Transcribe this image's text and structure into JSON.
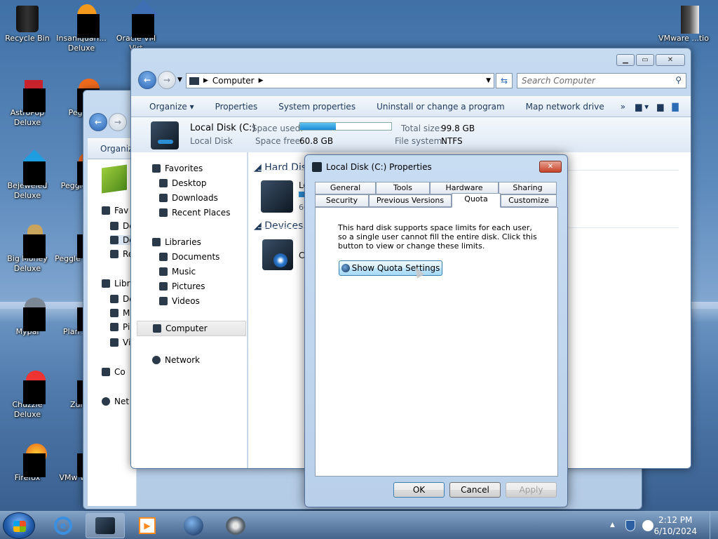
{
  "desktop": {
    "icons": [
      {
        "label": "Recycle Bin"
      },
      {
        "label": "Insaniquari... Deluxe"
      },
      {
        "label": "Oracle VM Virt"
      },
      {
        "label": "VMware ...tio"
      },
      {
        "label": "AstroPop Deluxe"
      },
      {
        "label": "Peggle"
      },
      {
        "label": "Bejeweled Deluxe"
      },
      {
        "label": "Peggle Del"
      },
      {
        "label": "Big Money Deluxe"
      },
      {
        "label": "Peggle of War"
      },
      {
        "label": "Mypal"
      },
      {
        "label": "Plan Zom"
      },
      {
        "label": "Chuzzle Deluxe"
      },
      {
        "label": "Zuma"
      },
      {
        "label": "Firefox"
      },
      {
        "label": "VMw Works"
      }
    ]
  },
  "back_window": {
    "toolbar_organize": "Organiz",
    "nav": [
      "Fav",
      "De",
      "De",
      "Re",
      "Libr",
      "De",
      "M",
      "Pi",
      "Vi",
      "Co",
      "Net"
    ]
  },
  "explorer": {
    "address_path": "Computer",
    "search_placeholder": "Search Computer",
    "toolbar": {
      "organize": "Organize",
      "properties": "Properties",
      "system_properties": "System properties",
      "uninstall": "Uninstall or change a program",
      "map_drive": "Map network drive",
      "more": "»"
    },
    "details": {
      "name": "Local Disk (C:)",
      "type": "Local Disk",
      "space_used_label": "Space used:",
      "space_free_label": "Space free:",
      "space_free_value": "60.8 GB",
      "total_size_label": "Total size:",
      "total_size_value": "99.8 GB",
      "filesystem_label": "File system:",
      "filesystem_value": "NTFS",
      "used_fraction": 0.39
    },
    "nav": {
      "favorites": "Favorites",
      "desktop": "Desktop",
      "downloads": "Downloads",
      "recent": "Recent Places",
      "libraries": "Libraries",
      "documents": "Documents",
      "music": "Music",
      "pictures": "Pictures",
      "videos": "Videos",
      "computer": "Computer",
      "network": "Network"
    },
    "content": {
      "hard_disk_group": "Hard Dis",
      "disk_label_partial": "Lo",
      "disk_free_partial": "60",
      "devices_group": "Devices w",
      "device_label_partial": "C"
    }
  },
  "dialog": {
    "title": "Local Disk (C:) Properties",
    "tabs_row1": [
      "General",
      "Tools",
      "Hardware",
      "Sharing"
    ],
    "tabs_row2": [
      "Security",
      "Previous Versions",
      "Quota",
      "Customize"
    ],
    "active_tab": "Quota",
    "description": "This hard disk supports space limits for each user, so a single user cannot fill the entire disk. Click this button to view or change these limits.",
    "show_quota_button": "Show Quota Settings",
    "ok": "OK",
    "cancel": "Cancel",
    "apply": "Apply"
  },
  "taskbar": {
    "time": "2:12 PM",
    "date": "6/10/2024"
  }
}
